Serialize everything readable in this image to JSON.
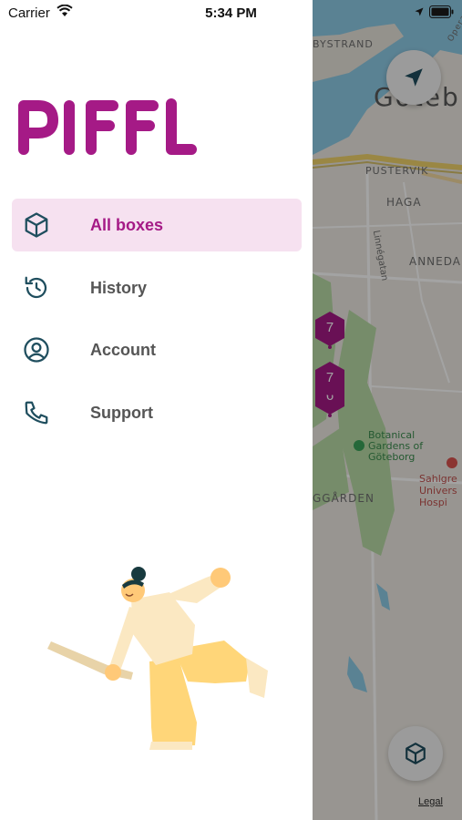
{
  "status_bar": {
    "carrier": "Carrier",
    "time": "5:34 PM"
  },
  "brand": {
    "logo_text": "PIFFL",
    "primary_color": "#a51a86",
    "active_bg_color": "#f6e1f0",
    "icon_color": "#1f4e5e"
  },
  "menu": {
    "items": [
      {
        "label": "All boxes",
        "icon": "box-icon",
        "active": true
      },
      {
        "label": "History",
        "icon": "history-icon",
        "active": false
      },
      {
        "label": "Account",
        "icon": "account-icon",
        "active": false
      },
      {
        "label": "Support",
        "icon": "phone-icon",
        "active": false
      }
    ]
  },
  "map": {
    "labels": {
      "bystrand": "BYSTRAND",
      "city": "Göteb",
      "pustervik": "PUSTERVIK",
      "haga": "HAGA",
      "annedal": "ANNEDA",
      "linnegatan": "Linnégatan",
      "botanical": "Botanical\nGardens of\nGöteborg",
      "sahlgrenska": "Sahlgre\nUnivers\nHospi",
      "gargarden": "GGÅRDEN",
      "opera": "Opera"
    },
    "markers": [
      {
        "count": "7"
      },
      {
        "count": "7"
      },
      {
        "count": "6"
      }
    ],
    "legal": "Legal"
  }
}
